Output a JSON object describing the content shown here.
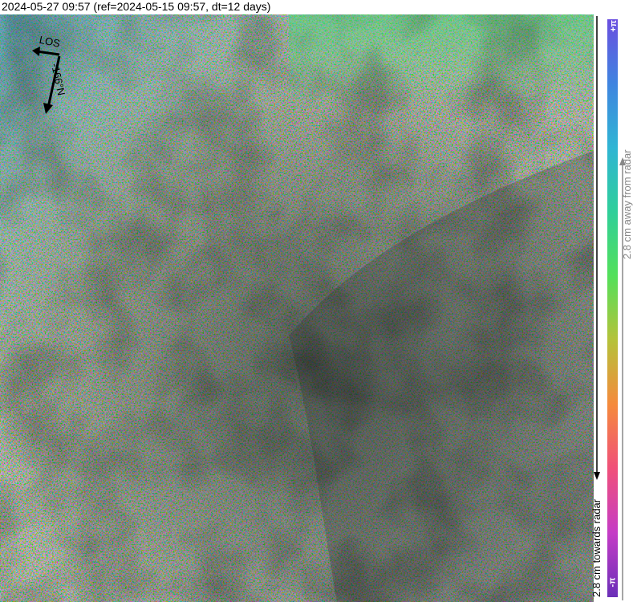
{
  "title": "2024-05-27 09:57 (ref=2024-05-15 09:57, dt=12 days)",
  "compass": {
    "los_label": "LOS",
    "heading_label": "-166°N"
  },
  "colorbar": {
    "top_label": "+π",
    "bottom_label": "-π",
    "towards_label": "2.8 cm towards radar",
    "away_label": "2.8 cm away from radar",
    "colors": [
      "#6a2fb8",
      "#c53cc6",
      "#f0507a",
      "#f58a3c",
      "#b5c23a",
      "#53e05a",
      "#2fcf9a",
      "#2fb5d4",
      "#3f84e0",
      "#6a4ee0"
    ]
  },
  "image": {
    "description_colors": [
      "#7f9a7a",
      "#8c8f6e",
      "#6a8f9a",
      "#9a8577",
      "#5d6a66",
      "#3f4a48"
    ]
  }
}
